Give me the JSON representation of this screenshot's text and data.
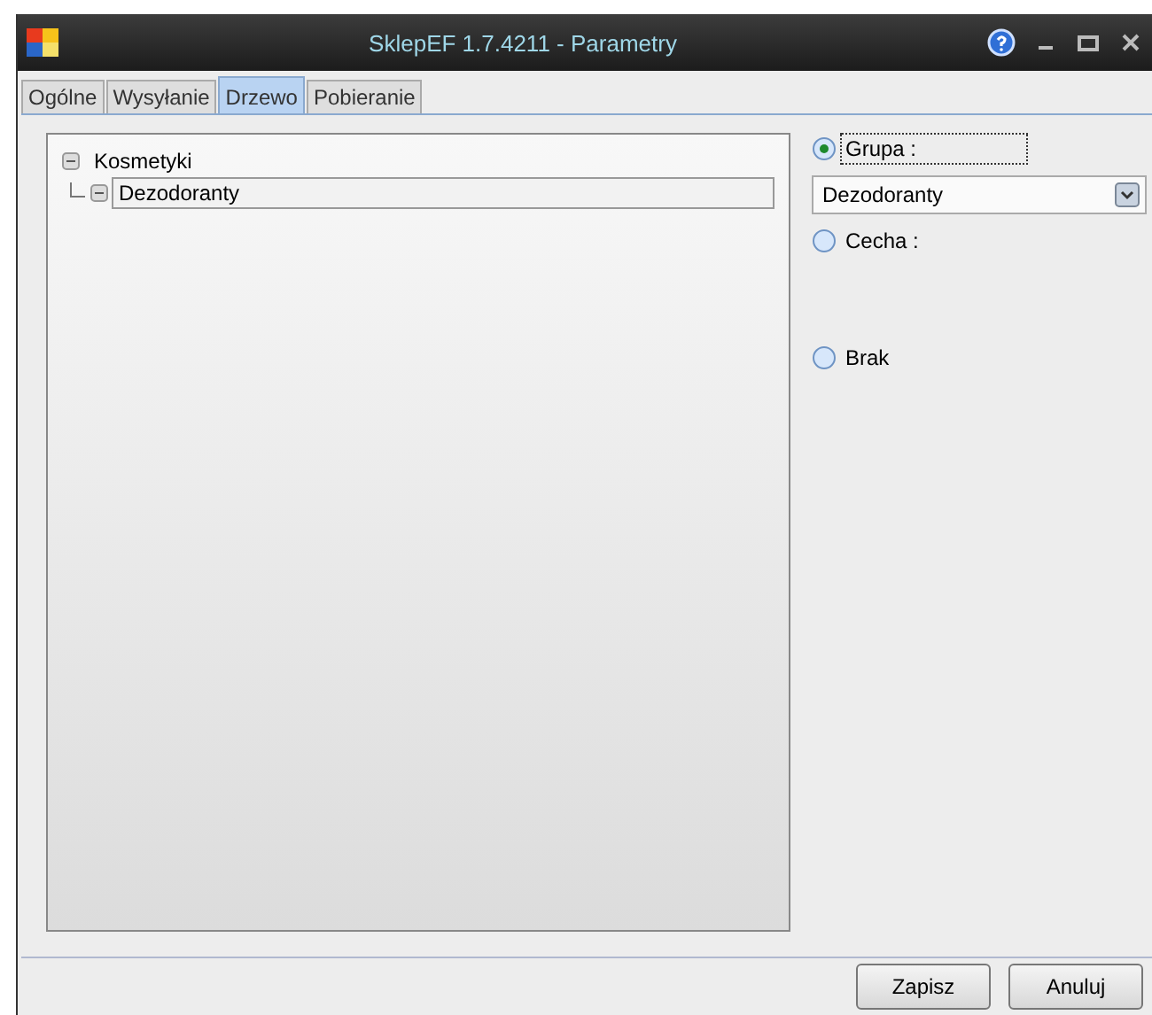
{
  "window": {
    "title": "SklepEF 1.7.4211 - Parametry"
  },
  "tabs": [
    {
      "label": "Ogólne",
      "selected": false
    },
    {
      "label": "Wysyłanie",
      "selected": false
    },
    {
      "label": "Drzewo",
      "selected": true
    },
    {
      "label": "Pobieranie",
      "selected": false
    }
  ],
  "tree": [
    {
      "label": "Kosmetyki",
      "expanded": true,
      "selected": false,
      "children": [
        {
          "label": "Dezodoranty",
          "expanded": true,
          "selected": true
        }
      ]
    }
  ],
  "options": [
    {
      "kind": "radio",
      "label": "Grupa :",
      "selected": true,
      "focused": true
    },
    {
      "kind": "dropdown",
      "value": "Dezodoranty"
    },
    {
      "kind": "radio",
      "label": "Cecha :",
      "selected": false,
      "focused": false
    },
    {
      "kind": "spacer"
    },
    {
      "kind": "radio",
      "label": "Brak",
      "selected": false,
      "focused": false
    }
  ],
  "buttons": [
    "Zapisz",
    "Anuluj"
  ]
}
